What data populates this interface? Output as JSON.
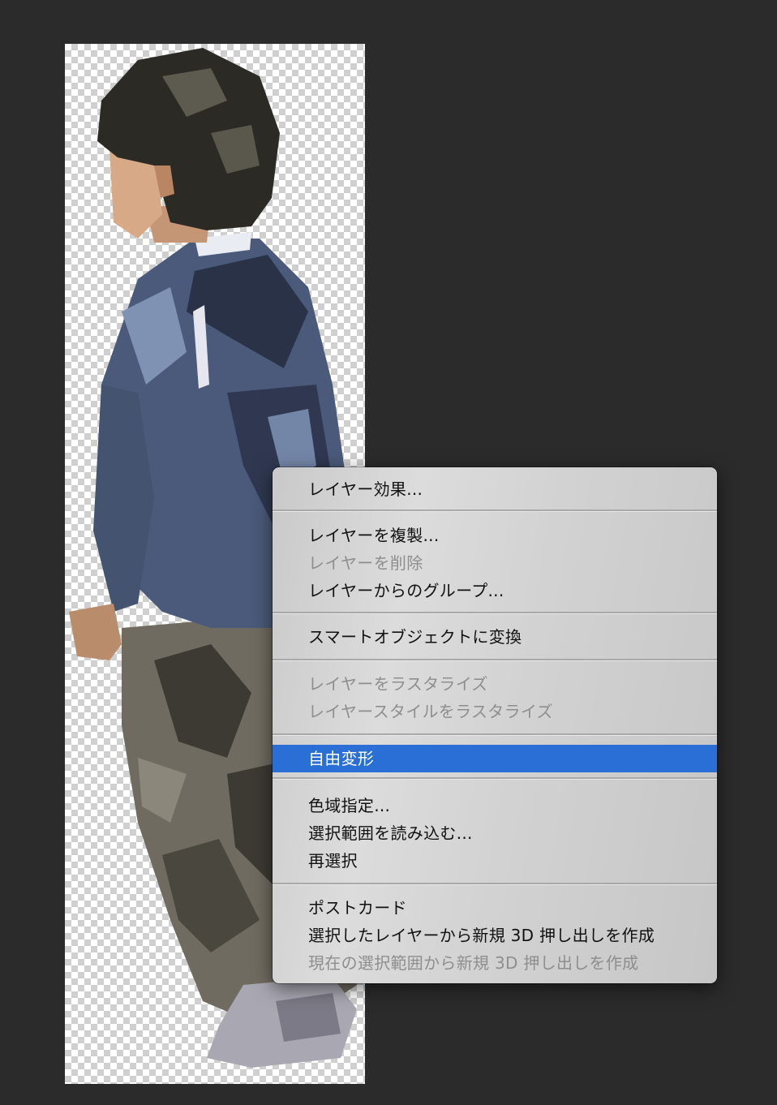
{
  "menu": {
    "groups": [
      {
        "items": [
          {
            "label": "レイヤー効果...",
            "enabled": true
          }
        ]
      },
      {
        "items": [
          {
            "label": "レイヤーを複製...",
            "enabled": true
          },
          {
            "label": "レイヤーを削除",
            "enabled": false
          },
          {
            "label": "レイヤーからのグループ...",
            "enabled": true
          }
        ]
      },
      {
        "items": [
          {
            "label": "スマートオブジェクトに変換",
            "enabled": true
          }
        ]
      },
      {
        "items": [
          {
            "label": "レイヤーをラスタライズ",
            "enabled": false
          },
          {
            "label": "レイヤースタイルをラスタライズ",
            "enabled": false
          }
        ]
      },
      {
        "items": [
          {
            "label": "自由変形",
            "enabled": true,
            "highlighted": true
          }
        ]
      },
      {
        "items": [
          {
            "label": "色域指定...",
            "enabled": true
          },
          {
            "label": "選択範囲を読み込む...",
            "enabled": true
          },
          {
            "label": "再選択",
            "enabled": true
          }
        ]
      },
      {
        "items": [
          {
            "label": "ポストカード",
            "enabled": true
          },
          {
            "label": "選択したレイヤーから新規 3D 押し出しを作成",
            "enabled": true
          },
          {
            "label": "現在の選択範囲から新規 3D 押し出しを作成",
            "enabled": false
          }
        ]
      }
    ]
  },
  "colors": {
    "workspace": "#2b2b2b",
    "highlight": "#2a6fd6",
    "text_enabled": "#111111",
    "text_disabled": "#8e8e8e"
  }
}
